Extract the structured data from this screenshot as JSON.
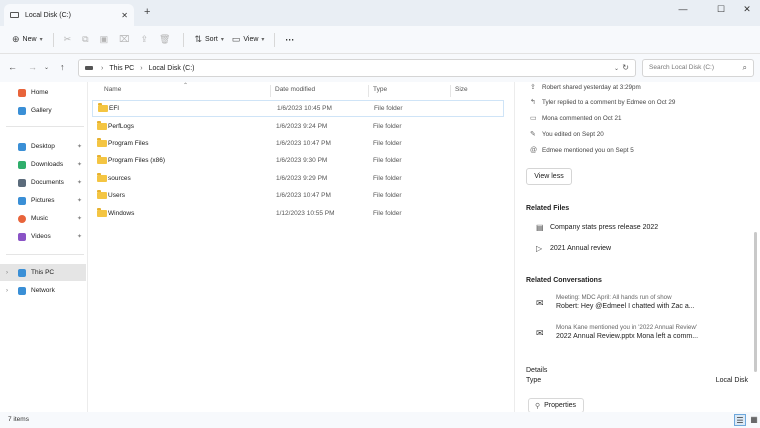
{
  "window": {
    "tab_title": "Local Disk (C:)",
    "new_tab": "+",
    "tab_close": "✕",
    "minimize": "—",
    "maximize": "☐",
    "close": "✕"
  },
  "commands": {
    "new": "New",
    "sort": "Sort",
    "view": "View",
    "more": "···"
  },
  "address": {
    "crumbs": [
      "This PC",
      "Local Disk (C:)"
    ],
    "search_placeholder": "Search Local Disk (C:)"
  },
  "sidebar": {
    "top": [
      {
        "label": "Home",
        "color": "#e8643b"
      },
      {
        "label": "Gallery",
        "color": "#3a8fd6"
      }
    ],
    "pinned": [
      {
        "label": "Desktop",
        "color": "#3a8fd6"
      },
      {
        "label": "Downloads",
        "color": "#2fae6b"
      },
      {
        "label": "Documents",
        "color": "#5b6b7b"
      },
      {
        "label": "Pictures",
        "color": "#3a8fd6"
      },
      {
        "label": "Music",
        "color": "#e8643b"
      },
      {
        "label": "Videos",
        "color": "#8a53c6"
      }
    ],
    "drives": [
      {
        "label": "This PC",
        "color": "#3a8fd6"
      },
      {
        "label": "Network",
        "color": "#3a8fd6"
      }
    ]
  },
  "columns": {
    "name": "Name",
    "date": "Date modified",
    "type": "Type",
    "size": "Size"
  },
  "files": [
    {
      "name": "EFI",
      "date": "1/6/2023 10:45 PM",
      "type": "File folder"
    },
    {
      "name": "PerfLogs",
      "date": "1/6/2023 9:24 PM",
      "type": "File folder"
    },
    {
      "name": "Program Files",
      "date": "1/6/2023 10:47 PM",
      "type": "File folder"
    },
    {
      "name": "Program Files (x86)",
      "date": "1/6/2023 9:30 PM",
      "type": "File folder"
    },
    {
      "name": "sources",
      "date": "1/6/2023 9:29 PM",
      "type": "File folder"
    },
    {
      "name": "Users",
      "date": "1/6/2023 10:47 PM",
      "type": "File folder"
    },
    {
      "name": "Windows",
      "date": "1/12/2023 10:55 PM",
      "type": "File folder"
    }
  ],
  "details": {
    "activity": [
      {
        "icon": "⇪",
        "text": "Robert shared yesterday at 3:29pm"
      },
      {
        "icon": "↰",
        "text": "Tyler replied to a comment by Edmee on Oct 29"
      },
      {
        "icon": "▭",
        "text": "Mona commented on Oct 21"
      },
      {
        "icon": "✎",
        "text": "You edited on Sept 20"
      },
      {
        "icon": "@",
        "text": "Edmee mentioned you on Sept 5"
      }
    ],
    "view_less": "View less",
    "related_files_title": "Related Files",
    "related_files": [
      {
        "icon": "▤",
        "name": "Company stats press release 2022"
      },
      {
        "icon": "▷",
        "name": "2021 Annual review"
      }
    ],
    "related_conv_title": "Related Conversations",
    "conversations": [
      {
        "line1": "Meeting: MDC April: All hands run of show",
        "line2": "Robert: Hey @Edmeel I chatted with Zac a..."
      },
      {
        "line1": "Mona Kane mentioned you in '2022 Annual Review'",
        "line2": "2022 Annual Review.pptx Mona left a comm..."
      }
    ],
    "details_title": "Details",
    "type_label": "Type",
    "type_value": "Local Disk",
    "properties": "Properties"
  },
  "status": {
    "items": "7 items"
  }
}
